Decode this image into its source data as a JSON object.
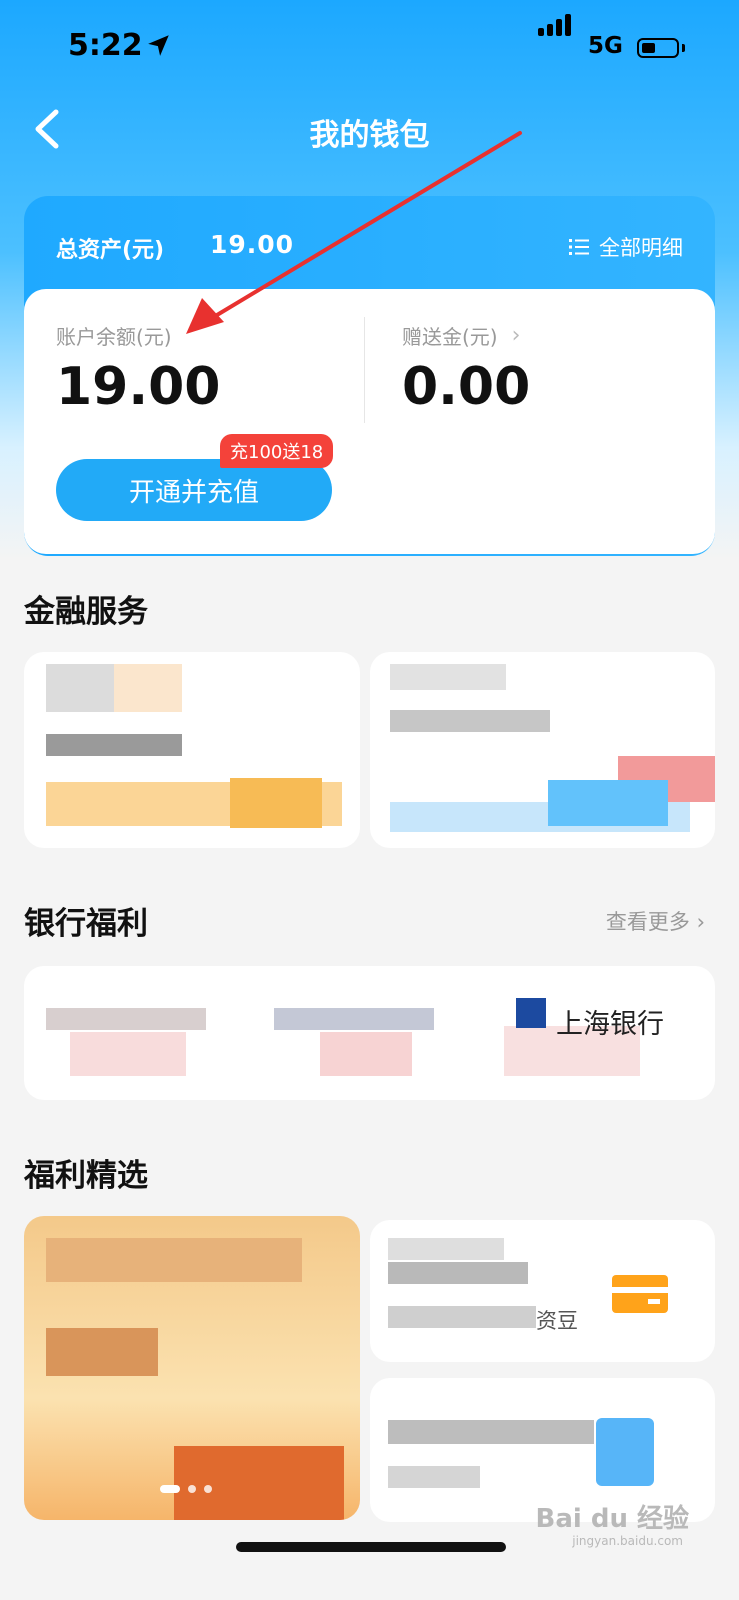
{
  "status": {
    "time": "5:22",
    "network": "5G",
    "battery_level": 0.4
  },
  "header": {
    "title": "我的钱包"
  },
  "assets": {
    "label": "总资产(元)",
    "value": "19.00",
    "detail_link": "全部明细",
    "balance_label": "账户余额(元)",
    "balance_value": "19.00",
    "gift_label": "赠送金(元)",
    "gift_value": "0.00",
    "promo_badge": "充100送18",
    "open_button": "开通并充值"
  },
  "sections": {
    "finance": "金融服务",
    "bank": "银行福利",
    "bank_more": "查看更多 ›",
    "bank_name": "上海银行",
    "welfare": "福利精选",
    "welfare_tail": "资豆"
  },
  "watermark": {
    "main": "Bai du 经验",
    "sub": "jingyan.baidu.com"
  },
  "colors": {
    "accent": "#22aaf7",
    "promo": "#f4423a",
    "arrow": "#e8312f"
  }
}
